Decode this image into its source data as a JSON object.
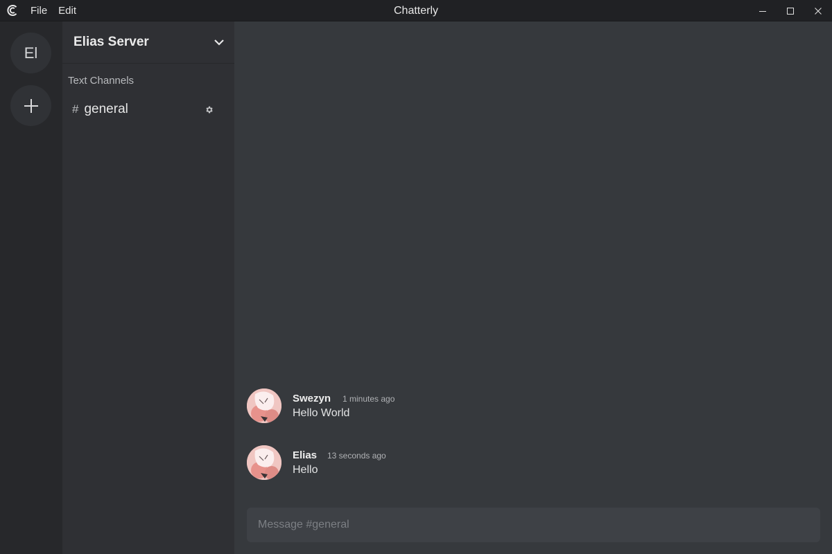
{
  "window": {
    "title": "Chatterly",
    "menu": [
      "File",
      "Edit"
    ],
    "controls": [
      "minimize-icon",
      "maximize-icon",
      "close-icon"
    ]
  },
  "servers": [
    {
      "label": "El"
    },
    {
      "label": "+",
      "icon": "plus-icon"
    }
  ],
  "sidebar": {
    "server_name": "Elias Server",
    "section_label": "Text Channels",
    "channels": [
      {
        "hash": "#",
        "name": "general",
        "icon": "gear-icon"
      }
    ]
  },
  "messages": [
    {
      "author": "Swezyn",
      "time": "1 minutes ago",
      "text": "Hello World"
    },
    {
      "author": "Elias",
      "time": "13 seconds ago",
      "text": "Hello"
    }
  ],
  "composer": {
    "placeholder": "Message #general"
  },
  "colors": {
    "titlebar": "#202124",
    "server_rail": "#27282b",
    "sidebar": "#2f3034",
    "chat_bg": "#36393d",
    "composer_bg": "#3e4146"
  }
}
